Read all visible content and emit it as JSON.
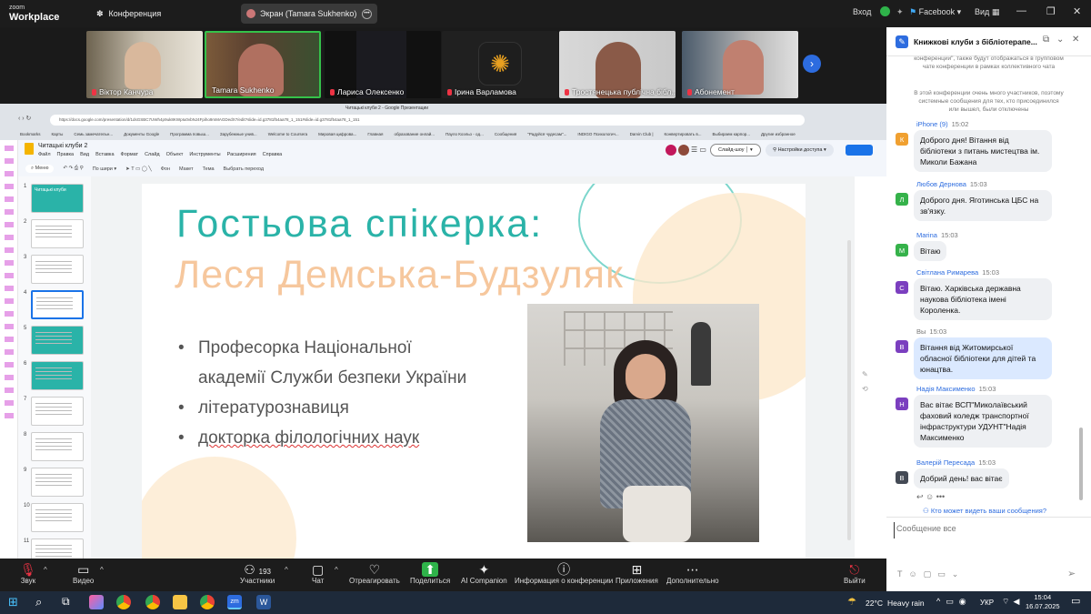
{
  "titlebar": {
    "logo_line1": "zoom",
    "logo_line2": "Workplace",
    "tabs": [
      {
        "label": "Конференция"
      },
      {
        "label": "Экран (Tamara Sukhenko)"
      }
    ],
    "signin": "Вход",
    "facebook": "Facebook",
    "view": "Вид"
  },
  "participants": [
    {
      "name": "Віктор Канчура"
    },
    {
      "name": "Tamara Sukhenko"
    },
    {
      "name": "Лариса Олексенко"
    },
    {
      "name": "Ірина Варламова"
    },
    {
      "name": "Тростянецька публічна бібл..."
    },
    {
      "name": "Абонемент"
    }
  ],
  "browser": {
    "tab_title": "Читацькі клуби 2 - Google Презентации",
    "url": "https://docs.google.com/presentation/d/1dsGSBC7UWh4p9uk8KWpIu0vbNJ4Fpiho9mMAGDedX7/edit?slide=id.g3781f54aa78_1_151#slide=id.g3781f54aa78_1_151",
    "bookmarks": [
      "Bookmarks",
      "Карты",
      "Семь замечательн...",
      "Документы Google",
      "Программа повыш...",
      "Зарубежные унив...",
      "Welcome to Coursera",
      "Мировая цифрова...",
      "Главная",
      "образование онлай...",
      "Пауло Коэльо - од...",
      "Сообщения",
      "\"Радуйся чудесам\"...",
      "INDIGO Психологич...",
      "Darvin Club |",
      "Конвертировать в...",
      "Выбираем карпор...",
      "Другие избранное"
    ]
  },
  "slides_app": {
    "doc_title": "Читацькі клуби 2",
    "menu": [
      "Файл",
      "Правка",
      "Вид",
      "Вставка",
      "Формат",
      "Слайд",
      "Объект",
      "Инструменты",
      "Расширения",
      "Справка"
    ],
    "search": "Меню",
    "zoom": "По шири",
    "toolbar_items": [
      "Фон",
      "Макет",
      "Тема",
      "Выбрать переход"
    ],
    "slideshow": "Слайд-шоу",
    "access": "Настройки доступа",
    "thumb_numbers": [
      "1",
      "2",
      "3",
      "4",
      "5",
      "6",
      "7",
      "8",
      "9",
      "10",
      "11"
    ],
    "thumb1_text": "Читацькі клуби"
  },
  "slide": {
    "title": "Гостьова спікерка:",
    "speaker": "Леся Демська-Будзуляк",
    "bullets": [
      "Професорка Національної",
      "академії Служби безпеки України",
      "літературознавиця",
      "докторка філологічних наук"
    ]
  },
  "chat": {
    "title": "Книжкові клуби з бібліотерапе...",
    "system_text_1": "конференции\", также будут отображаться в групповом чате конференции в рамках коллективного чата",
    "system_text_2": "В этой конференции очень много участников, поэтому системные сообщения для тех, кто присоединился или вышел, были отключены",
    "messages": [
      {
        "sender": "iPhone (9)",
        "time": "15:02",
        "avatar": "К",
        "color": "#f0a030",
        "text": "Доброго дня! Вітання від бібліотеки з питань мистецтва ім. Миколи Бажана"
      },
      {
        "sender": "Любов Дернова",
        "time": "15:03",
        "avatar": "Л",
        "color": "#35b24a",
        "text": "Доброго дня. Яготинська ЦБС на зв'язку."
      },
      {
        "sender": "Marina",
        "time": "15:03",
        "avatar": "M",
        "color": "#35b24a",
        "text": "Вітаю"
      },
      {
        "sender": "Світлана Римарева",
        "time": "15:03",
        "avatar": "С",
        "color": "#7b3fbf",
        "text": "Вітаю. Харківська державна наукова бібліотека імені Короленка."
      },
      {
        "sender": "Вы",
        "time": "15:03",
        "avatar": "В",
        "color": "#7b3fbf",
        "text": "Вітання від Житомирської обласної бібліотеки для дітей та юнацтва."
      },
      {
        "sender": "Надія Максименко",
        "time": "15:03",
        "avatar": "Н",
        "color": "#7b3fbf",
        "text": "Вас вітає ВСП\"Миколаївський фаховий коледж транспортної інфраструктури УДУНТ\"Надія Максименко"
      },
      {
        "sender": "Валерій Пересада",
        "time": "15:03",
        "avatar": "В",
        "color": "#444a55",
        "text": "Добрий день! вас вітає"
      }
    ],
    "who_sees": "Кто может видеть ваши сообщения?",
    "input_placeholder": "Сообщение все"
  },
  "toolbar": {
    "mute": "Звук",
    "video": "Видео",
    "participants": "Участники",
    "participants_count": "193",
    "chat": "Чат",
    "react": "Отреагировать",
    "share": "Поделиться",
    "ai": "AI Companion",
    "info": "Информация о конференции",
    "apps": "Приложения",
    "more": "Дополнительно",
    "leave": "Выйти"
  },
  "taskbar": {
    "weather": "22°C",
    "weather_desc": "Heavy rain",
    "lang": "УКР",
    "time": "15:04",
    "date": "16.07.2025"
  }
}
